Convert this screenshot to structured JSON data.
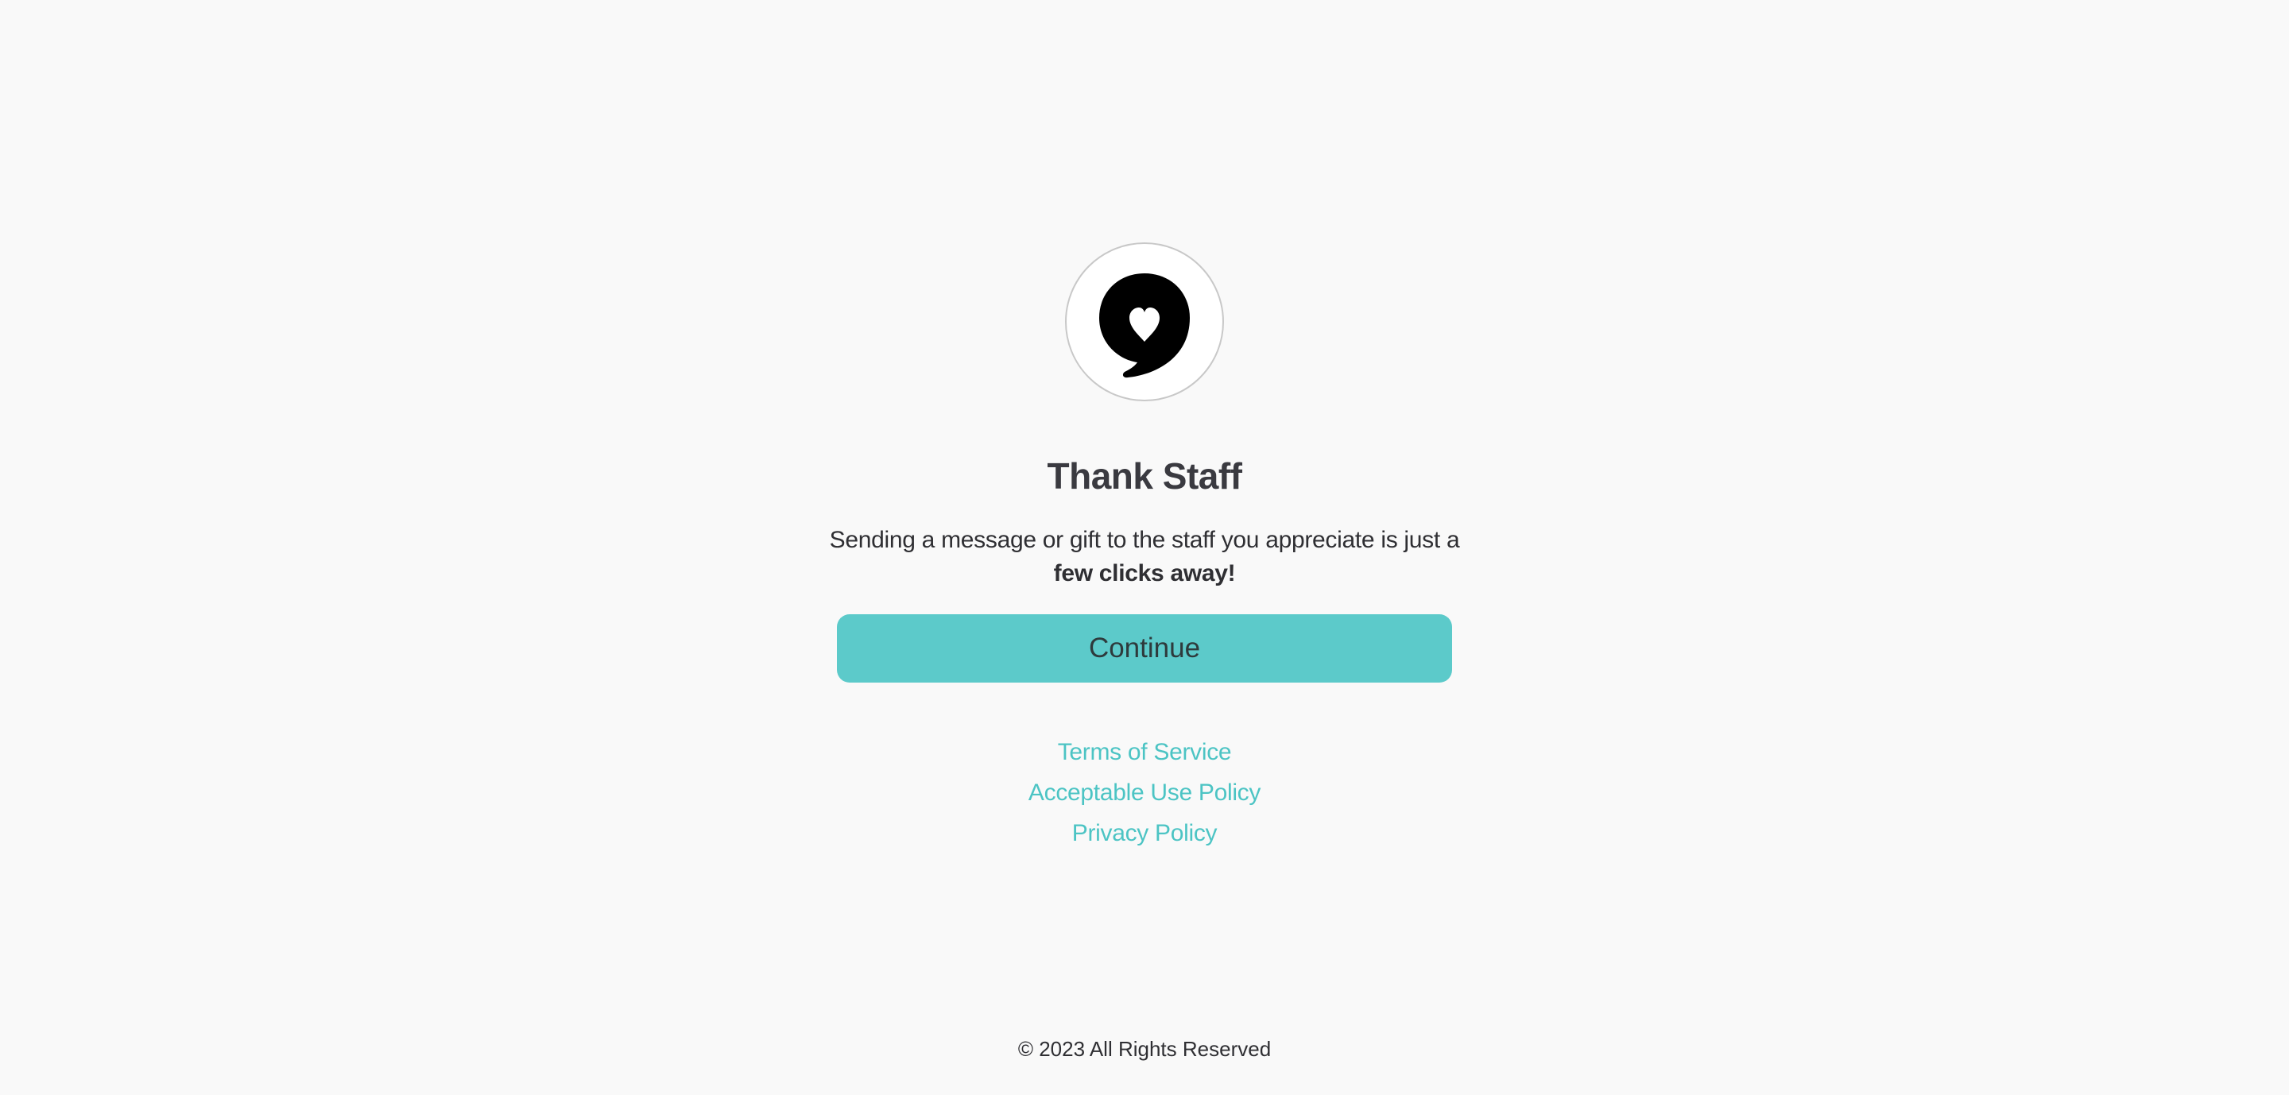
{
  "brand": {
    "logo_icon": "heart-speech-bubble-icon",
    "title": "Thank Staff"
  },
  "message": {
    "text": "Sending a message or gift to the staff you appreciate is just a",
    "emphasis": "few clicks away!"
  },
  "actions": {
    "continue_label": "Continue"
  },
  "links": [
    {
      "label": "Terms of Service"
    },
    {
      "label": "Acceptable Use Policy"
    },
    {
      "label": "Privacy Policy"
    }
  ],
  "footer": {
    "copyright": "© 2023 All Rights Reserved"
  },
  "colors": {
    "accent": "#5ccaca",
    "link": "#4cc4c4",
    "background": "#f9f9f9",
    "text": "#3a3a40"
  }
}
